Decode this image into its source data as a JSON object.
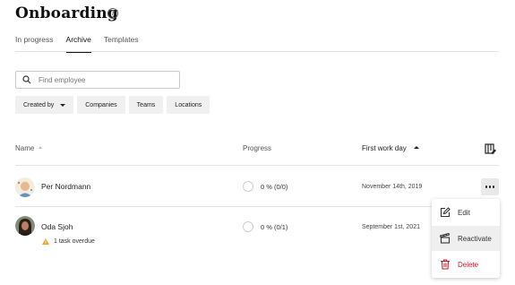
{
  "page": {
    "title": "Onboarding"
  },
  "tabs": [
    {
      "label": "In progress"
    },
    {
      "label": "Archive",
      "active": true
    },
    {
      "label": "Templates"
    }
  ],
  "search": {
    "placeholder": "Find employee",
    "value": ""
  },
  "filters": [
    {
      "label": "Created by",
      "has_dropdown": true
    },
    {
      "label": "Companies"
    },
    {
      "label": "Teams"
    },
    {
      "label": "Locations"
    }
  ],
  "table": {
    "columns": {
      "name": "Name",
      "progress": "Progress",
      "first_work_day": "First work day"
    },
    "sorted_by": "First work day",
    "sort_direction": "ascending",
    "rows": [
      {
        "name": "Per Nordmann",
        "progress": "0 % (0/0)",
        "first_work_day": "November 14th, 2019"
      },
      {
        "name": "Oda Sjoh",
        "progress": "0 % (0/1)",
        "first_work_day": "September 1st, 2021",
        "warning": "1 task overdue"
      }
    ]
  },
  "row_menu": {
    "items": [
      {
        "label": "Edit",
        "icon": "edit-icon"
      },
      {
        "label": "Reactivate",
        "icon": "reactivate-icon"
      },
      {
        "label": "Delete",
        "icon": "trash-icon"
      }
    ]
  },
  "colors": {
    "danger": "#c0202a",
    "warning": "#f0a030",
    "accent_text": "#111111"
  }
}
